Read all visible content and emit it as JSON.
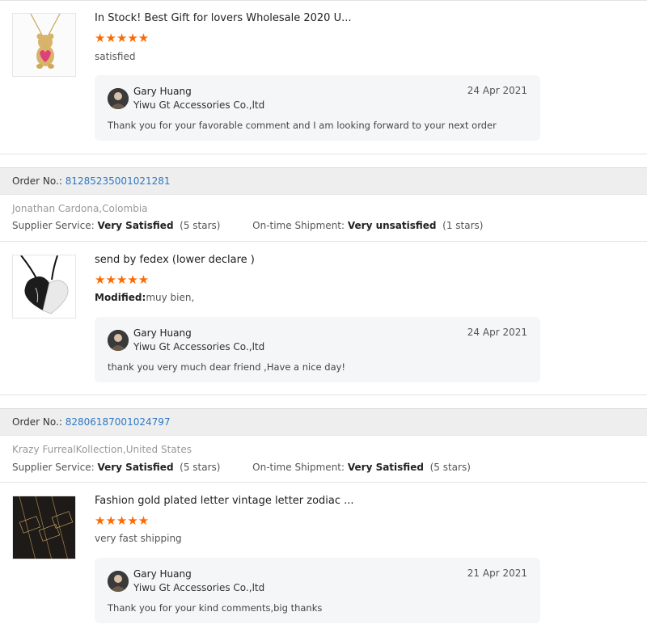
{
  "reviews": [
    {
      "product_title": "In Stock! Best Gift for lovers Wholesale 2020 U...",
      "stars": "★★★★★",
      "comment": "satisfied",
      "reply": {
        "name": "Gary Huang",
        "company": "Yiwu Gt Accessories Co.,ltd",
        "date": "24 Apr 2021",
        "message": "Thank you for your favorable comment and I am looking forward to your next order"
      }
    },
    {
      "order_label": "Order No.:",
      "order_number": "81285235001021281",
      "buyer": "Jonathan Cardona,Colombia",
      "supplier_label": "Supplier Service:",
      "supplier_value": "Very Satisfied",
      "supplier_stars": "(5 stars)",
      "shipment_label": "On-time Shipment:",
      "shipment_value": "Very unsatisfied",
      "shipment_stars": "(1 stars)",
      "product_title": "send by fedex (lower declare )",
      "stars": "★★★★★",
      "comment_label": "Modified:",
      "comment": "muy bien,",
      "reply": {
        "name": "Gary Huang",
        "company": "Yiwu Gt Accessories Co.,ltd",
        "date": "24 Apr 2021",
        "message": "thank you very much dear friend ,Have a nice day!"
      }
    },
    {
      "order_label": "Order No.:",
      "order_number": "82806187001024797",
      "buyer": "Krazy FurrealKollection,United States",
      "supplier_label": "Supplier Service:",
      "supplier_value": "Very Satisfied",
      "supplier_stars": "(5 stars)",
      "shipment_label": "On-time Shipment:",
      "shipment_value": "Very Satisfied",
      "shipment_stars": "(5 stars)",
      "product_title": "Fashion gold plated letter vintage letter zodiac ...",
      "stars": "★★★★★",
      "comment": "very fast shipping",
      "reply": {
        "name": "Gary Huang",
        "company": "Yiwu Gt Accessories Co.,ltd",
        "date": "21 Apr 2021",
        "message": "Thank you for your kind comments,big thanks"
      }
    }
  ],
  "colors": {
    "star": "#ff6a00",
    "order_link": "#2f78c4",
    "reply_bg": "#f5f6f8"
  }
}
